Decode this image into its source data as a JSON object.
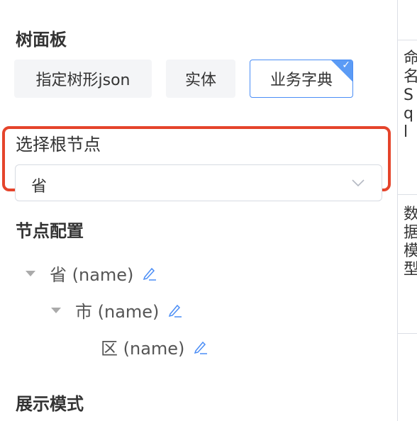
{
  "tree_panel": {
    "title": "树面板",
    "options": [
      "指定树形json",
      "实体",
      "业务字典"
    ],
    "selected_option": "业务字典"
  },
  "root_node": {
    "label": "选择根节点",
    "select_value": "省"
  },
  "node_config": {
    "title": "节点配置",
    "nodes": [
      {
        "label": "省 (name)"
      },
      {
        "label": "市 (name)"
      },
      {
        "label": "区 (name)"
      }
    ]
  },
  "display_mode": {
    "title": "展示模式"
  },
  "right_panel": {
    "label1_chars": [
      "命",
      "名",
      "S",
      "q",
      "l"
    ],
    "label2_chars": [
      "数",
      "据",
      "模",
      "型"
    ]
  },
  "colors": {
    "accent": "#4a8df6",
    "highlight": "#e5442b"
  }
}
